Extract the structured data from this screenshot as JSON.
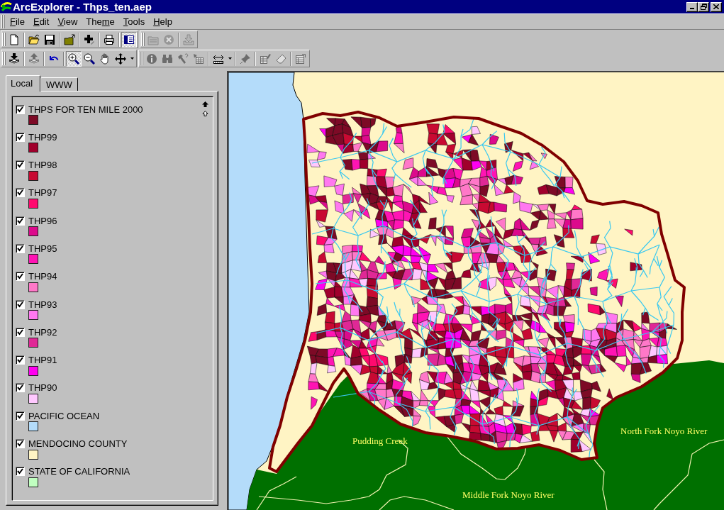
{
  "window": {
    "title": "ArcExplorer - Thps_ten.aep"
  },
  "menu": [
    {
      "key": "F",
      "after": "ile"
    },
    {
      "key": "E",
      "after": "dit"
    },
    {
      "key": "V",
      "after": "iew"
    },
    {
      "before": "The",
      "key": "m",
      "after": "e"
    },
    {
      "key": "T",
      "after": "ools"
    },
    {
      "key": "H",
      "after": "elp"
    }
  ],
  "toolbars": [
    {
      "bands": [
        {
          "groups": [
            {
              "buttons": [
                {
                  "kind": "new",
                  "pressed": false,
                  "disabled": false
                }
              ]
            },
            {
              "buttons": [
                {
                  "kind": "open",
                  "pressed": false,
                  "disabled": false
                },
                {
                  "kind": "save",
                  "pressed": false,
                  "disabled": false
                }
              ]
            },
            {
              "buttons": [
                {
                  "kind": "folder-up",
                  "pressed": false,
                  "disabled": false
                }
              ]
            },
            {
              "buttons": [
                {
                  "kind": "add",
                  "pressed": false,
                  "disabled": false
                }
              ]
            },
            {
              "buttons": [
                {
                  "kind": "print",
                  "pressed": false,
                  "disabled": false
                }
              ]
            },
            {
              "buttons": [
                {
                  "kind": "legend",
                  "pressed": true,
                  "disabled": false
                }
              ]
            }
          ]
        },
        {
          "groups": [
            {
              "buttons": [
                {
                  "kind": "folder",
                  "pressed": false,
                  "disabled": true
                },
                {
                  "kind": "close-circle",
                  "pressed": false,
                  "disabled": true
                }
              ]
            },
            {
              "buttons": [
                {
                  "kind": "tray",
                  "pressed": false,
                  "disabled": true
                }
              ]
            }
          ]
        }
      ]
    },
    {
      "bands": [
        {
          "groups": [
            {
              "buttons": [
                {
                  "kind": "add-theme",
                  "pressed": false,
                  "disabled": false
                }
              ]
            },
            {
              "buttons": [
                {
                  "kind": "remove-theme",
                  "pressed": false,
                  "disabled": true
                }
              ]
            },
            {
              "buttons": [
                {
                  "kind": "undo",
                  "pressed": false,
                  "disabled": false
                }
              ]
            },
            {
              "buttons": [
                {
                  "kind": "zoom-in",
                  "pressed": true,
                  "disabled": false
                },
                {
                  "kind": "zoom-out",
                  "pressed": false,
                  "disabled": false
                },
                {
                  "kind": "pan",
                  "pressed": false,
                  "disabled": false
                },
                {
                  "kind": "move",
                  "pressed": false,
                  "disabled": false
                },
                {
                  "kind": "caret",
                  "pressed": false,
                  "disabled": false
                }
              ]
            }
          ]
        },
        {
          "groups": [
            {
              "buttons": [
                {
                  "kind": "info",
                  "pressed": false,
                  "disabled": true
                },
                {
                  "kind": "find",
                  "pressed": false,
                  "disabled": true
                },
                {
                  "kind": "hammer",
                  "pressed": false,
                  "disabled": true
                },
                {
                  "kind": "select",
                  "pressed": false,
                  "disabled": true
                }
              ]
            },
            {
              "buttons": [
                {
                  "kind": "measure",
                  "pressed": false,
                  "disabled": false
                },
                {
                  "kind": "caret",
                  "pressed": false,
                  "disabled": false
                }
              ]
            },
            {
              "buttons": [
                {
                  "kind": "pin",
                  "pressed": false,
                  "disabled": true
                }
              ]
            },
            {
              "buttons": [
                {
                  "kind": "table-edit",
                  "pressed": false,
                  "disabled": true
                },
                {
                  "kind": "eraser",
                  "pressed": false,
                  "disabled": true
                }
              ]
            },
            {
              "buttons": [
                {
                  "kind": "properties",
                  "pressed": false,
                  "disabled": true
                }
              ]
            }
          ]
        }
      ]
    }
  ],
  "legend_panel": {
    "tabs": [
      {
        "label": "Local",
        "selected": true
      },
      {
        "label": "WWW",
        "selected": false
      }
    ],
    "layers": [
      {
        "name": "THPS FOR TEN MILE 2000",
        "checked": true,
        "color": "#7d0a26"
      },
      {
        "name": "THP99",
        "checked": true,
        "color": "#a0002c"
      },
      {
        "name": "THP98",
        "checked": true,
        "color": "#c80a32"
      },
      {
        "name": "THP97",
        "checked": true,
        "color": "#ff0a6e"
      },
      {
        "name": "THP96",
        "checked": true,
        "color": "#dc0a8c"
      },
      {
        "name": "THP95",
        "checked": true,
        "color": "#ff14b4"
      },
      {
        "name": "THP94",
        "checked": true,
        "color": "#ff78c8"
      },
      {
        "name": "THP93",
        "checked": true,
        "color": "#ff78f0"
      },
      {
        "name": "THP92",
        "checked": true,
        "color": "#e02896"
      },
      {
        "name": "THP91",
        "checked": true,
        "color": "#ff00f0"
      },
      {
        "name": "THP90",
        "checked": true,
        "color": "#ffc8ff"
      },
      {
        "name": "PACIFIC OCEAN",
        "checked": true,
        "color": "#b4dcfa"
      },
      {
        "name": "MENDOCINO COUNTY",
        "checked": true,
        "color": "#fff4c4"
      },
      {
        "name": "STATE OF CALIFORNIA",
        "checked": true,
        "color": "#c0ffc0"
      }
    ]
  },
  "map": {
    "labels": [
      "Pudding Creek",
      "North Fork Noyo River",
      "Middle Fork Noyo River"
    ]
  }
}
